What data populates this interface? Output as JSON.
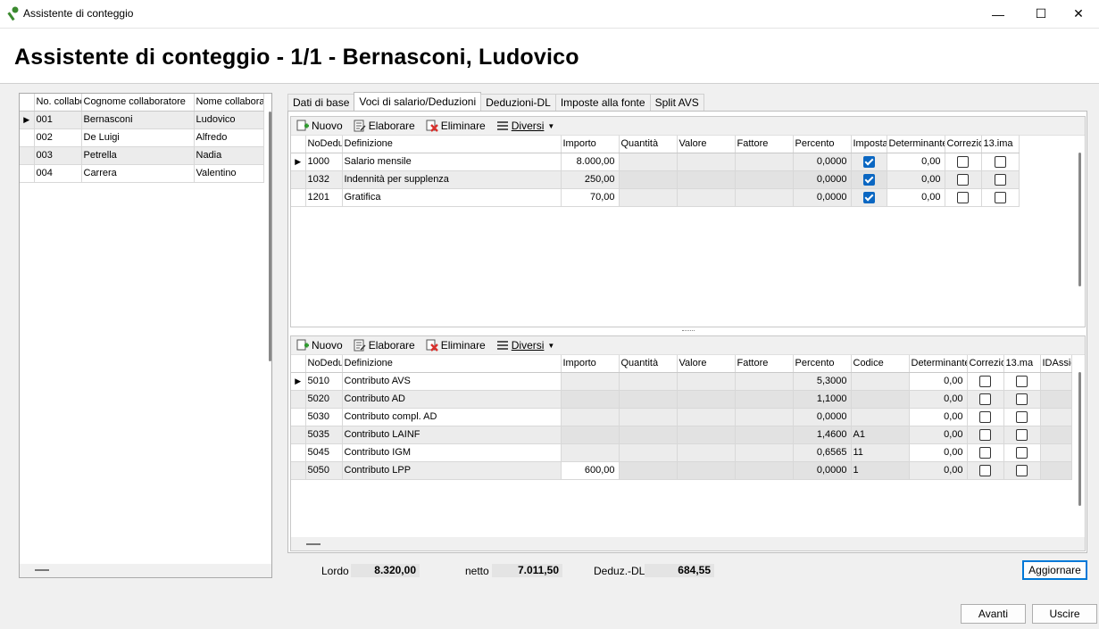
{
  "window": {
    "title": "Assistente di conteggio",
    "controls": {
      "minimize": "—",
      "maximize": "☐",
      "close": "✕"
    }
  },
  "page_title": "Assistente di conteggio - 1/1 - Bernasconi, Ludovico",
  "employees": {
    "columns": [
      "No. collabo",
      "Cognome collaboratore",
      "Nome collaborat"
    ],
    "rows": [
      {
        "no": "001",
        "surname": "Bernasconi",
        "name": "Ludovico",
        "current": true
      },
      {
        "no": "002",
        "surname": "De Luigi",
        "name": "Alfredo",
        "current": false
      },
      {
        "no": "003",
        "surname": "Petrella",
        "name": "Nadia",
        "current": false
      },
      {
        "no": "004",
        "surname": "Carrera",
        "name": "Valentino",
        "current": false
      }
    ]
  },
  "tabs": [
    "Dati di base",
    "Voci di salario/Deduzioni",
    "Deduzioni-DL",
    "Imposte alla fonte",
    "Split AVS"
  ],
  "active_tab": 1,
  "toolbar": {
    "new": "Nuovo",
    "edit": "Elaborare",
    "delete": "Eliminare",
    "more": "Diversi"
  },
  "salary": {
    "columns": [
      "NoDedu",
      "Definizione",
      "Importo",
      "Quantità",
      "Valore",
      "Fattore",
      "Percento",
      "Imposta",
      "Determinante",
      "Correzio",
      "13.ima"
    ],
    "rows": [
      {
        "no": "1000",
        "def": "Salario mensile",
        "importo": "8.000,00",
        "percento": "0,0000",
        "imposta": true,
        "determinante": "0,00",
        "correzione": false,
        "tredicesima": false,
        "current": true
      },
      {
        "no": "1032",
        "def": "Indennità per supplenza",
        "importo": "250,00",
        "percento": "0,0000",
        "imposta": true,
        "determinante": "0,00",
        "correzione": false,
        "tredicesima": false,
        "current": false
      },
      {
        "no": "1201",
        "def": "Gratifica",
        "importo": "70,00",
        "percento": "0,0000",
        "imposta": true,
        "determinante": "0,00",
        "correzione": false,
        "tredicesima": false,
        "current": false
      }
    ]
  },
  "deductions": {
    "columns": [
      "NoDedu",
      "Definizione",
      "Importo",
      "Quantità",
      "Valore",
      "Fattore",
      "Percento",
      "Codice",
      "Determinante",
      "Correzio",
      "13.ma",
      "IDAssic"
    ],
    "rows": [
      {
        "no": "5010",
        "def": "Contributo AVS",
        "importo": "",
        "percento": "5,3000",
        "codice": "",
        "determinante": "0,00",
        "current": true
      },
      {
        "no": "5020",
        "def": "Contributo AD",
        "importo": "",
        "percento": "1,1000",
        "codice": "",
        "determinante": "0,00",
        "current": false
      },
      {
        "no": "5030",
        "def": "Contributo compl. AD",
        "importo": "",
        "percento": "0,0000",
        "codice": "",
        "determinante": "0,00",
        "current": false
      },
      {
        "no": "5035",
        "def": "Contributo LAINF",
        "importo": "",
        "percento": "1,4600",
        "codice": "A1",
        "determinante": "0,00",
        "current": false
      },
      {
        "no": "5045",
        "def": "Contributo IGM",
        "importo": "",
        "percento": "0,6565",
        "codice": "11",
        "determinante": "0,00",
        "current": false
      },
      {
        "no": "5050",
        "def": "Contributo LPP",
        "importo": "600,00",
        "percento": "0,0000",
        "codice": "1",
        "determinante": "0,00",
        "current": false
      }
    ]
  },
  "totals": {
    "lordo_label": "Lordo",
    "lordo": "8.320,00",
    "netto_label": "netto",
    "netto": "7.011,50",
    "dl_label": "Deduz.-DL",
    "dl": "684,55"
  },
  "buttons": {
    "update": "Aggiornare",
    "next": "Avanti",
    "exit": "Uscire"
  },
  "colors": {
    "check_blue": "#0b67c2",
    "new_icon": "#2e9b2e",
    "delete_icon": "#d9302c",
    "focus_border": "#0078d7"
  },
  "icons": {
    "current_row": "▶"
  }
}
